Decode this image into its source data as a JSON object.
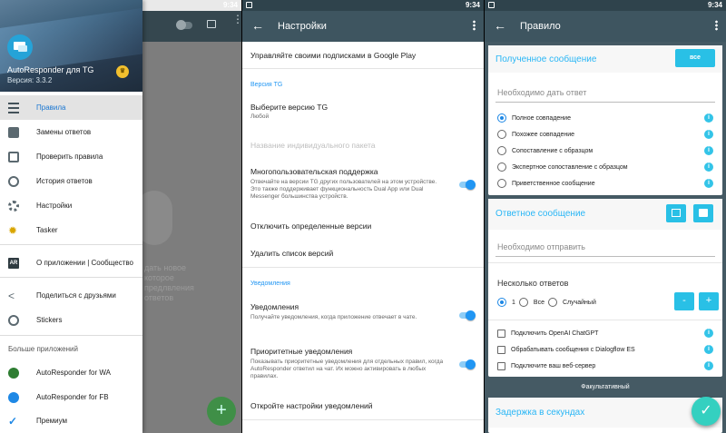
{
  "status": {
    "time": "9:34"
  },
  "drawer": {
    "app_name": "AutoResponder для TG",
    "version": "Версия: 3.3.2",
    "items": [
      {
        "label": "Правила"
      },
      {
        "label": "Замены ответов"
      },
      {
        "label": "Проверить правила"
      },
      {
        "label": "История ответов"
      },
      {
        "label": "Настройки"
      },
      {
        "label": "Tasker"
      },
      {
        "label": "О приложении | Сообщество"
      },
      {
        "label": "Поделиться с друзьями"
      },
      {
        "label": "Stickers"
      },
      {
        "label": "AutoResponder for WA"
      },
      {
        "label": "AutoResponder for FB"
      },
      {
        "label": "Премиум"
      }
    ],
    "more_apps_header": "Больше приложений"
  },
  "background_app": {
    "empty_text": "дать новое\nкоторое\nпредлвления\nответов"
  },
  "settings": {
    "title": "Настройки",
    "manage_subscriptions": "Управляйте своими подписками в Google Play",
    "section_tg": "Версия TG",
    "choose_version": "Выберите версию TG",
    "choose_version_sub": "Любой",
    "package_name": "Название индивидуального пакета",
    "multiuser": "Многопользовательская поддержка",
    "multiuser_sub": "Отвечайте на версии TG других пользователей на этом устройстве. Это также поддерживает функциональность Dual App или Dual Messenger большинства устройств.",
    "disable_versions": "Отключить определенные версии",
    "delete_versions": "Удалить список версий",
    "section_notifications": "Уведомления",
    "notifications": "Уведомления",
    "notifications_sub": "Получайте уведомления, когда приложение отвечает в чате.",
    "priority": "Приоритетные уведомления",
    "priority_sub": "Показывать приоритетные уведомления для отдельных правил, когда AutoResponder ответил на чат. Их можно активировать в любых правилах.",
    "open_notif_settings": "Откройте настройки уведомлений"
  },
  "rule": {
    "title": "Правило",
    "received_header": "Полученное сообщение",
    "all_button": "все",
    "received_hint": "Необходимо дать ответ",
    "match_options": [
      {
        "label": "Полное совпадение",
        "selected": true
      },
      {
        "label": "Похожее совпадение",
        "selected": false
      },
      {
        "label": "Сопоставление с образцом",
        "selected": false
      },
      {
        "label": "Экспертное сопоставление с образцом",
        "selected": false
      },
      {
        "label": "Приветственное сообщение",
        "selected": false
      }
    ],
    "reply_header": "Ответное сообщение",
    "reply_hint": "Необходимо отправить",
    "multiple_replies": "Несколько ответов",
    "reply_modes": [
      {
        "label": "1",
        "selected": true
      },
      {
        "label": "Все",
        "selected": false
      },
      {
        "label": "Случайный",
        "selected": false
      }
    ],
    "minus": "-",
    "plus": "+",
    "checkboxes": [
      {
        "label": "Подключить OpenAI ChatGPT"
      },
      {
        "label": "Обрабатывать сообщения с Dialogflow ES"
      },
      {
        "label": "Подключите ваш веб-сервер"
      }
    ],
    "optional_label": "Факультативный",
    "delay_header": "Задержка в секундах"
  },
  "colors": {
    "appbar": "#3e5560",
    "accent": "#29c0e6",
    "link": "#2196f3",
    "rule_bg": "#455a64"
  }
}
